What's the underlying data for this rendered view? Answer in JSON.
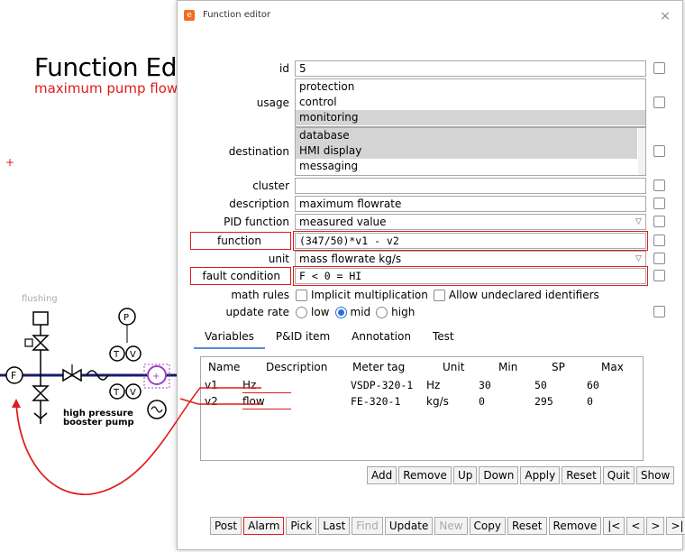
{
  "background": {
    "title": "Function Editor",
    "subtitle": "maximum pump flowrate",
    "flushing_label": "flushing",
    "pump_label_1": "high pressure",
    "pump_label_2": "booster pump",
    "instrument_p": "P",
    "instrument_t": "T",
    "instrument_v": "V",
    "instrument_f": "F",
    "plus_mark": "+"
  },
  "window": {
    "title": "Function editor",
    "close": "×"
  },
  "form": {
    "id_label": "id",
    "id_value": "5",
    "usage_label": "usage",
    "usage_options": [
      "protection",
      "control",
      "monitoring"
    ],
    "destination_label": "destination",
    "destination_options": [
      "database",
      "HMI display",
      "messaging"
    ],
    "cluster_label": "cluster",
    "cluster_value": "",
    "description_label": "description",
    "description_value": "maximum flowrate",
    "pid_function_label": "PID function",
    "pid_function_value": "measured value",
    "function_label": "function",
    "function_value": "(347/50)*v1 - v2",
    "unit_label": "unit",
    "unit_value": "mass flowrate kg/s",
    "fault_condition_label": "fault condition",
    "fault_condition_value": "F < 0 = HI",
    "math_rules_label": "math rules",
    "implicit_multiplication": "Implicit multiplication",
    "allow_undeclared": "Allow undeclared identifiers",
    "update_rate_label": "update rate",
    "rate_options": [
      "low",
      "mid",
      "high"
    ],
    "rate_selected": "mid"
  },
  "tabs": [
    "Variables",
    "P&ID item",
    "Annotation",
    "Test"
  ],
  "variables_table": {
    "headers": [
      "Name",
      "Description",
      "Meter tag",
      "Unit",
      "Min",
      "SP",
      "Max"
    ],
    "rows": [
      [
        "v1",
        "Hz",
        "VSDP-320-1",
        "Hz",
        "30",
        "50",
        "60"
      ],
      [
        "v2",
        "flow",
        "FE-320-1",
        "kg/s",
        "0",
        "295",
        "0"
      ]
    ]
  },
  "table_buttons": [
    "Add",
    "Remove",
    "Up",
    "Down",
    "Apply",
    "Reset",
    "Quit",
    "Show"
  ],
  "bottom_buttons": [
    "Post",
    "Alarm",
    "Pick",
    "Last",
    "Find",
    "Update",
    "New",
    "Copy",
    "Reset",
    "Remove",
    "|<",
    "<",
    ">",
    ">|"
  ],
  "colors": {
    "highlight_red": "#e01b1b",
    "selection_gray": "#d4d4d4",
    "radio_blue": "#2a6fd6",
    "pipe_blue": "#1a1a6e",
    "pump_purple": "#a040c0"
  }
}
